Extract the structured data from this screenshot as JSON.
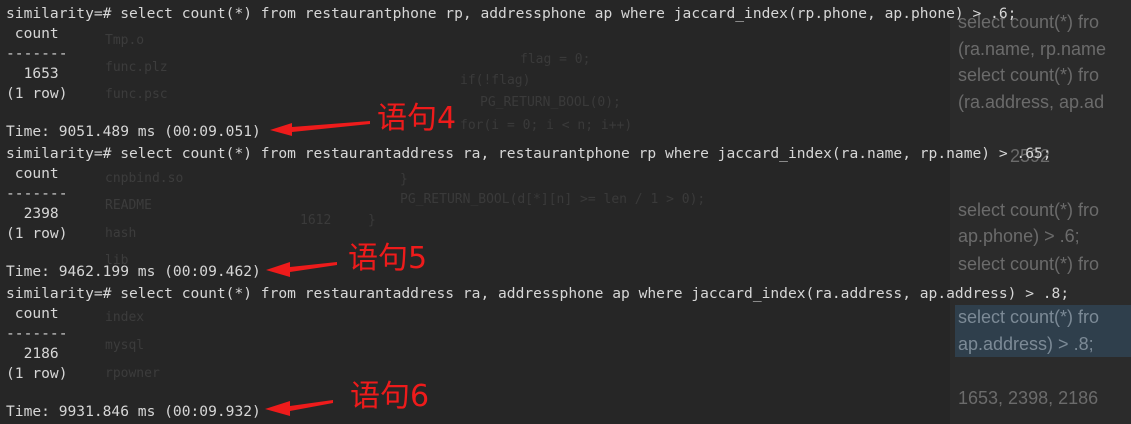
{
  "background_editor": {
    "file_items": [
      "Tmp.o",
      "func.plz",
      "func.psc",
      "cnpbind.so",
      "README",
      "hash",
      "lib",
      "index",
      "mysql",
      "rpowner"
    ],
    "code_lines": [
      "flag = 0;",
      "if(!flag)",
      "PG_RETURN_BOOL(0);",
      "for(i = 0; i < n; i++)",
      "}",
      "PG_RETURN_BOOL(d[*][n] >= len / 1 > 0);",
      "1612",
      "}"
    ]
  },
  "doc_panel": {
    "lines": [
      "select count(*) fro",
      "(ra.name, rp.name",
      "select count(*) fro",
      "(ra.address, ap.ad",
      "2592",
      "select count(*) fro",
      "ap.phone) > .6;",
      "select count(*) fro",
      "select count(*) fro",
      "ap.address) > .8;",
      "1653, 2398, 2186"
    ]
  },
  "terminal": {
    "lines": [
      "similarity=# select count(*) from restaurantphone rp, addressphone ap where jaccard_index(rp.phone, ap.phone) > .6;",
      " count",
      "-------",
      "  1653",
      "(1 row)",
      "",
      "Time: 9051.489 ms (00:09.051)",
      "similarity=# select count(*) from restaurantaddress ra, restaurantphone rp where jaccard_index(ra.name, rp.name) > .65;",
      " count",
      "-------",
      "  2398",
      "(1 row)",
      "",
      "Time: 9462.199 ms (00:09.462)",
      "similarity=# select count(*) from restaurantaddress ra, addressphone ap where jaccard_index(ra.address, ap.address) > .8;",
      " count",
      "-------",
      "  2186",
      "(1 row)",
      "",
      "Time: 9931.846 ms (00:09.932)"
    ]
  },
  "annotations": {
    "label1": "语句4",
    "label2": "语句5",
    "label3": "语句6",
    "color": "#ee1b1b"
  }
}
